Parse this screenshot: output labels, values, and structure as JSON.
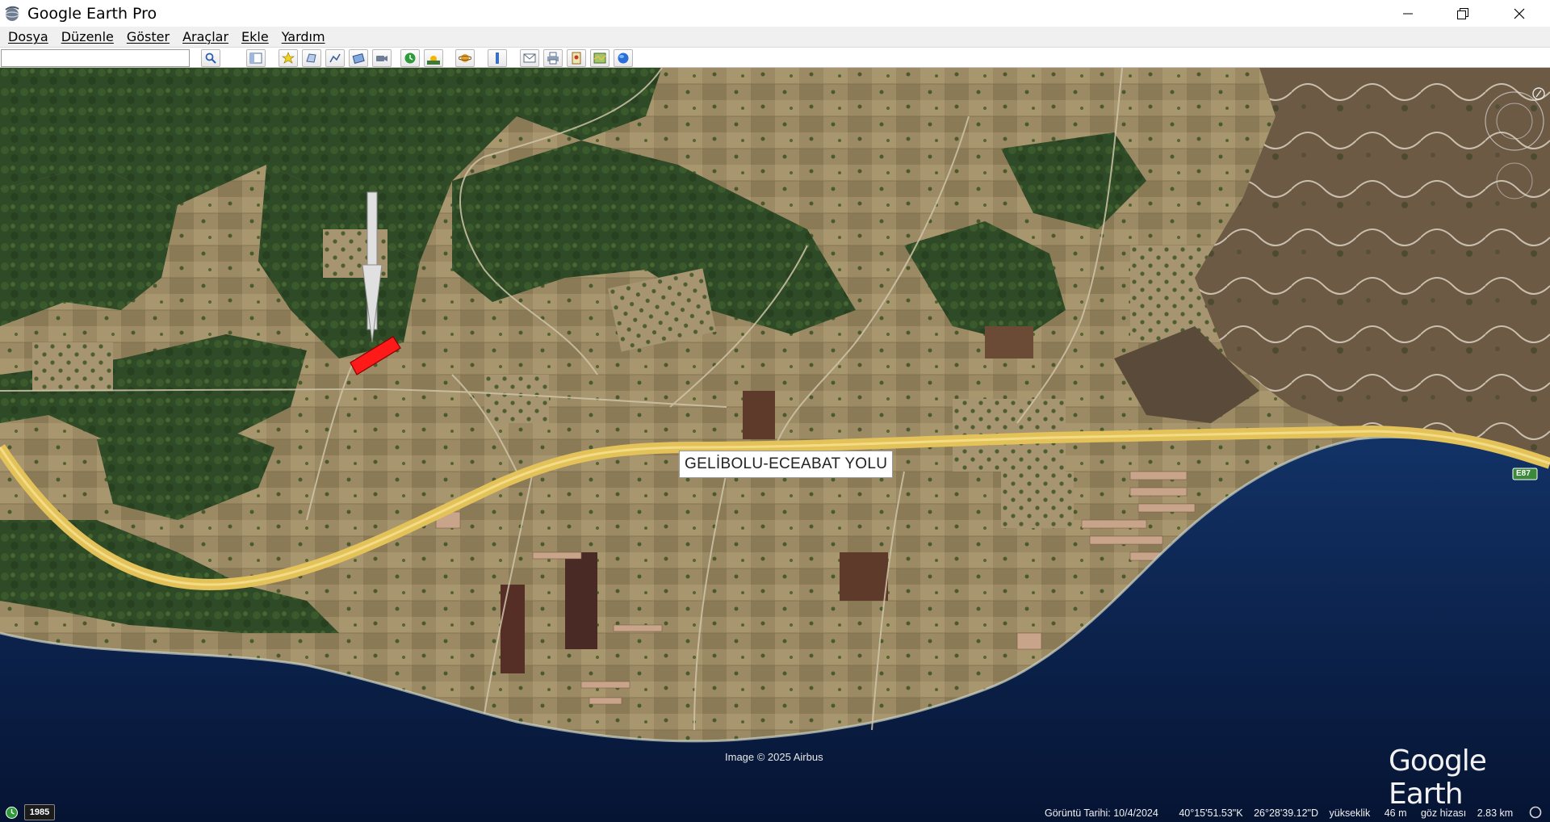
{
  "window": {
    "title": "Google Earth Pro"
  },
  "menu": [
    {
      "label": "Dosya"
    },
    {
      "label": "Düzenle"
    },
    {
      "label": "Göster"
    },
    {
      "label": "Araçlar"
    },
    {
      "label": "Ekle"
    },
    {
      "label": "Yardım"
    }
  ],
  "search": {
    "value": "",
    "placeholder": ""
  },
  "toolbar": {
    "icons": [
      "search-icon",
      "sidebar-toggle-icon",
      "add-placemark-icon",
      "add-polygon-icon",
      "add-path-icon",
      "add-image-overlay-icon",
      "record-tour-icon",
      "historical-imagery-icon",
      "sunlight-icon",
      "planets-icon",
      "ruler-icon",
      "email-icon",
      "print-icon",
      "save-image-icon",
      "map-view-icon",
      "google-maps-icon"
    ]
  },
  "map": {
    "road_label": "GELİBOLU-ECEABAT YOLU",
    "attribution": "Image © 2025 Airbus",
    "logo": "Google Earth",
    "highway_badge": "E87",
    "colors": {
      "sea": "#0b1f4a",
      "road": "#e3c25a",
      "parcel": "#ff1a1a",
      "arrow": "#d9d9d9"
    }
  },
  "status": {
    "imagery_date": "Görüntü Tarihi: 10/4/2024",
    "latitude": "40°15'51.53\"K",
    "longitude": "26°28'39.12\"D",
    "elevation_label": "yükseklik",
    "elevation_value": "46 m",
    "eye_label": "göz hizası",
    "eye_value": "2.83 km",
    "year": "1985"
  }
}
